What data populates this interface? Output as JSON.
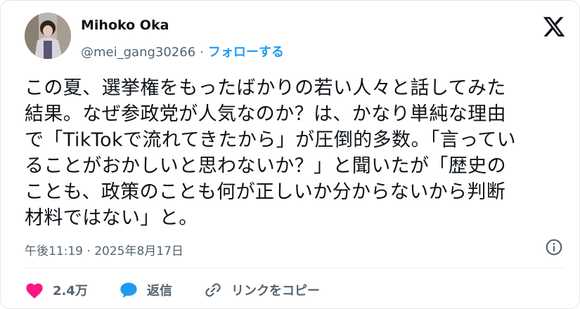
{
  "author": {
    "name": "Mihoko Oka",
    "handle": "@mei_gang30266",
    "separator": "·",
    "follow_label": "フォローする"
  },
  "tweet": {
    "lines": [
      "この夏、選挙権をもったばかりの若い人々と話してみた",
      "結果。なぜ参政党が人気なのか？は、かなり単純な理由",
      "で「TikTokで流れてきたから」が圧倒的多数。「言ってい",
      "ることがおかしいと思わないか？」と聞いたが「歴史の",
      "ことも、政策のことも何が正しいか分からないから判断",
      "材料ではない」と。"
    ]
  },
  "timestamp": "午後11:19 · 2025年8月17日",
  "actions": {
    "like_count": "2.4万",
    "reply_label": "返信",
    "copy_link_label": "リンクをコピー"
  },
  "icons": {
    "brand": "x-logo-icon",
    "info": "info-icon",
    "like": "heart-icon",
    "reply": "speech-bubble-icon",
    "copy_link": "link-icon"
  },
  "colors": {
    "text": "#0f1419",
    "secondary": "#536471",
    "accent": "#1d9bf0",
    "like": "#f91880",
    "divider": "#eff3f4"
  }
}
